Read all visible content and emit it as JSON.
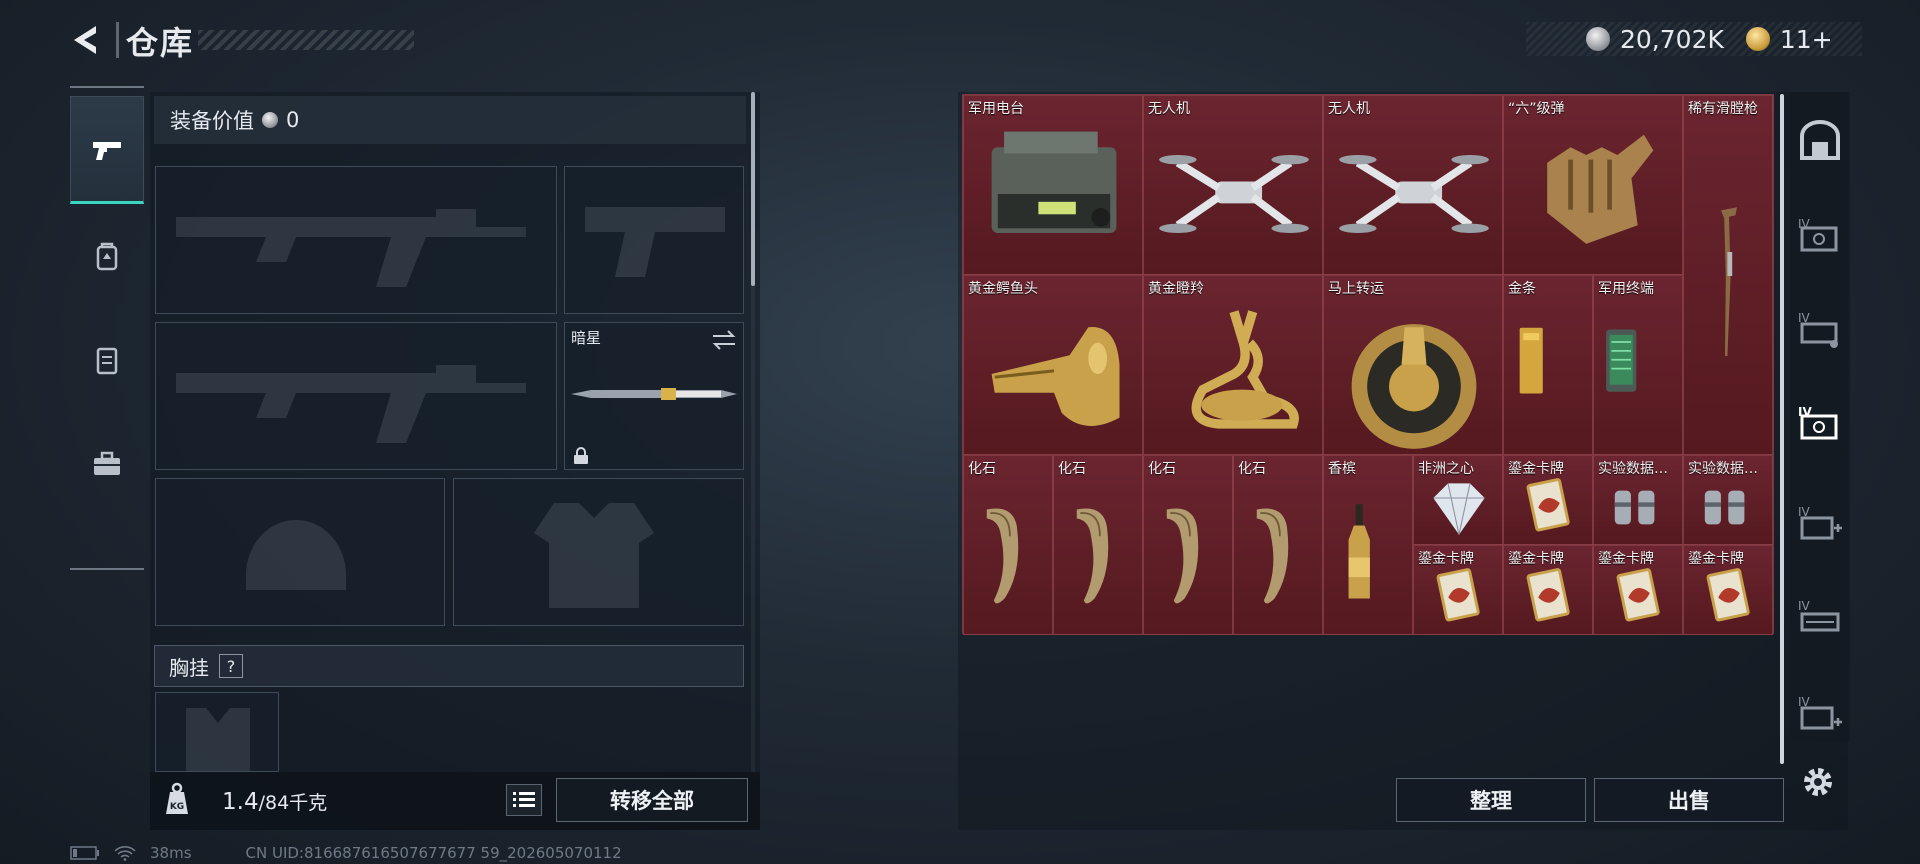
{
  "header": {
    "title": "仓库",
    "currency": [
      {
        "icon": "silver-coin-icon",
        "value": "20,702K"
      },
      {
        "icon": "gold-coin-icon",
        "value": "11+"
      }
    ]
  },
  "side_nav": {
    "items": [
      {
        "name": "weapons",
        "icon": "pistol-icon",
        "active": true
      },
      {
        "name": "backpack",
        "icon": "backpack-icon",
        "active": false
      },
      {
        "name": "armor",
        "icon": "vest-icon",
        "active": false
      },
      {
        "name": "toolbox",
        "icon": "toolbox-icon",
        "active": false
      }
    ]
  },
  "equipment": {
    "value_label": "装备价值",
    "value": "0",
    "melee_slot_label": "暗星",
    "chest_rig_label": "胸挂",
    "chest_rig_help": "?",
    "weight_current": "1.4",
    "weight_max": "/84千克",
    "transfer_all_label": "转移全部"
  },
  "storage": {
    "items": [
      {
        "label": "军用电台",
        "icon": "radio-icon",
        "col": 0,
        "row": 0
      },
      {
        "label": "无人机",
        "icon": "drone-icon",
        "col": 1,
        "row": 0
      },
      {
        "label": "无人机",
        "icon": "drone-icon",
        "col": 2,
        "row": 0
      },
      {
        "label": "“六”级弹",
        "icon": "shaka-hand-icon",
        "col": 3,
        "row": 0
      },
      {
        "label": "稀有滑膛枪",
        "icon": "musket-icon",
        "col": 4,
        "row": 0
      },
      {
        "label": "黄金鳄鱼头",
        "icon": "gold-crocodile-icon",
        "col": 0,
        "row": 1
      },
      {
        "label": "黄金瞪羚",
        "icon": "gold-gazelle-icon",
        "col": 1,
        "row": 1
      },
      {
        "label": "马上转运",
        "icon": "fortune-wheel-icon",
        "col": 2,
        "row": 1
      },
      {
        "label": "金条",
        "icon": "gold-bar-icon",
        "col": 3,
        "row": 1
      },
      {
        "label": "军用终端",
        "icon": "terminal-icon",
        "col": 3.5,
        "row": 1
      },
      {
        "label": "化石",
        "icon": "fossil-claw-icon"
      },
      {
        "label": "化石",
        "icon": "fossil-claw-icon"
      },
      {
        "label": "化石",
        "icon": "fossil-claw-icon"
      },
      {
        "label": "化石",
        "icon": "fossil-claw-icon"
      },
      {
        "label": "香槟",
        "icon": "champagne-icon"
      },
      {
        "label": "非洲之心",
        "icon": "diamond-icon"
      },
      {
        "label": "鎏金卡牌",
        "icon": "gold-card-icon"
      },
      {
        "label": "实验数据…",
        "icon": "data-canister-icon"
      },
      {
        "label": "实验数据…",
        "icon": "data-canister-icon"
      },
      {
        "label": "鎏金卡牌",
        "icon": "gold-card-icon"
      },
      {
        "label": "鎏金卡牌",
        "icon": "gold-card-icon"
      },
      {
        "label": "鎏金卡牌",
        "icon": "gold-card-icon"
      },
      {
        "label": "鎏金卡牌",
        "icon": "gold-card-icon"
      }
    ],
    "sort_label": "整理",
    "sell_label": "出售"
  },
  "right_tabs": [
    "all-storage-icon",
    "storage-iv-1-icon",
    "storage-iv-2-icon",
    "storage-iv-3-icon",
    "storage-iv-4-icon",
    "storage-iv-5-icon",
    "storage-iv-6-icon"
  ],
  "status_bar": {
    "ping": "38ms",
    "uid": "CN UID:816687616507677677 59_202605070112"
  },
  "colors": {
    "accent": "#3ad6c0",
    "grid_bg": "#5a1e26",
    "gold": "#c9a14a"
  }
}
